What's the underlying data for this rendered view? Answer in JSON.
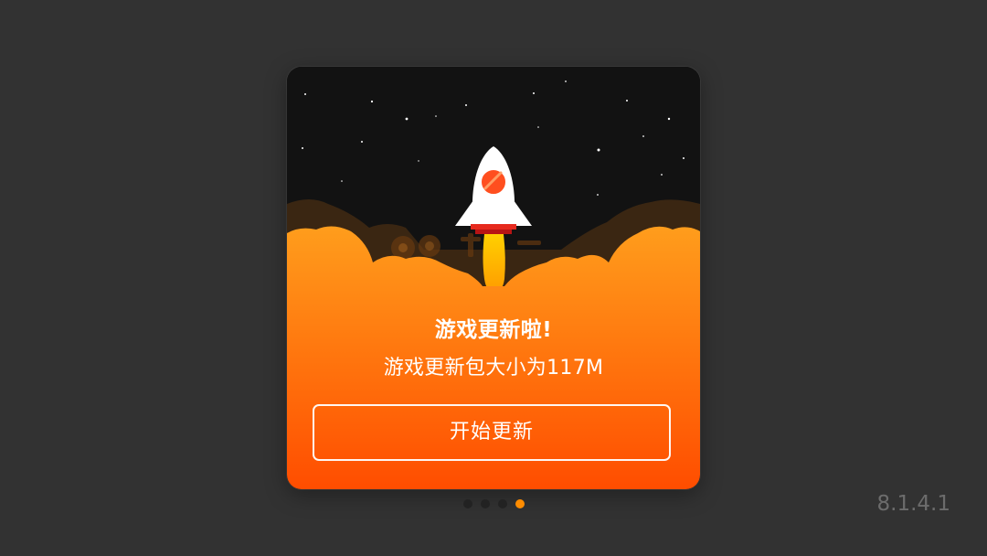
{
  "dialog": {
    "title": "游戏更新啦!",
    "subtitle": "游戏更新包大小为117M",
    "button_label": "开始更新"
  },
  "pager": {
    "total": 4,
    "active_index": 3
  },
  "version": "8.1.4.1",
  "icons": {
    "hero": "rocket-icon"
  },
  "colors": {
    "background": "#323232",
    "space": "#121212",
    "cloud_top": "#ff9a1f",
    "cloud_bottom": "#ff4e00",
    "flame": "#ffb300",
    "active_dot": "#ff8c00",
    "version_text": "#6c6c6c"
  }
}
